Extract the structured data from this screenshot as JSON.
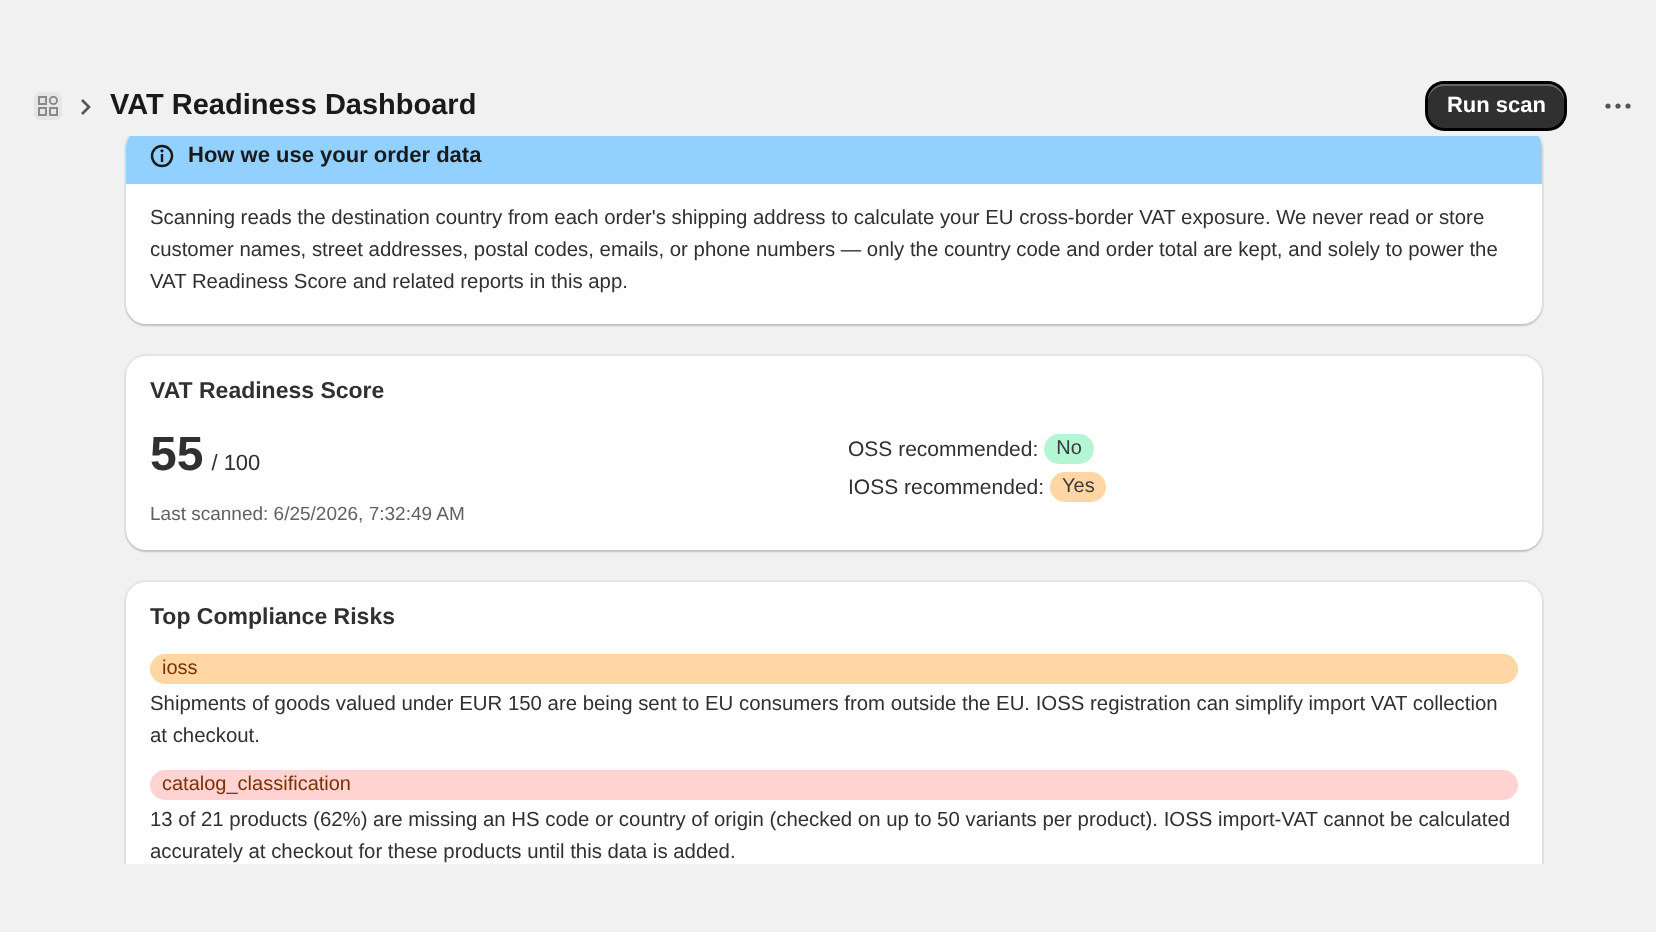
{
  "header": {
    "title": "VAT Readiness Dashboard",
    "primary_action": "Run scan"
  },
  "notice": {
    "title": "How we use your order data",
    "body": "Scanning reads the destination country from each order's shipping address to calculate your EU cross-border VAT exposure. We never read or store customer names, street addresses, postal codes, emails, or phone numbers — only the country code and order total are kept, and solely to power the VAT Readiness Score and related reports in this app."
  },
  "score_card": {
    "title": "VAT Readiness Score",
    "score": "55",
    "out_of": "/ 100",
    "last_scanned": "Last scanned: 6/25/2026, 7:32:49 AM",
    "recommendations": [
      {
        "label": "OSS recommended:",
        "value": "No",
        "color": "#b4f5d4"
      },
      {
        "label": "IOSS recommended:",
        "value": "Yes",
        "color": "#ffd6a4"
      }
    ]
  },
  "risks_card": {
    "title": "Top Compliance Risks",
    "risks": [
      {
        "tag": "ioss",
        "color": "#ffd6a4",
        "text": "Shipments of goods valued under EUR 150 are being sent to EU consumers from outside the EU. IOSS registration can simplify import VAT collection at checkout."
      },
      {
        "tag": "catalog_classification",
        "color": "#fed3d1",
        "text": "13 of 21 products (62%) are missing an HS code or country of origin (checked on up to 50 variants per product). IOSS import-VAT cannot be calculated accurately at checkout for these products until this data is added."
      }
    ]
  }
}
